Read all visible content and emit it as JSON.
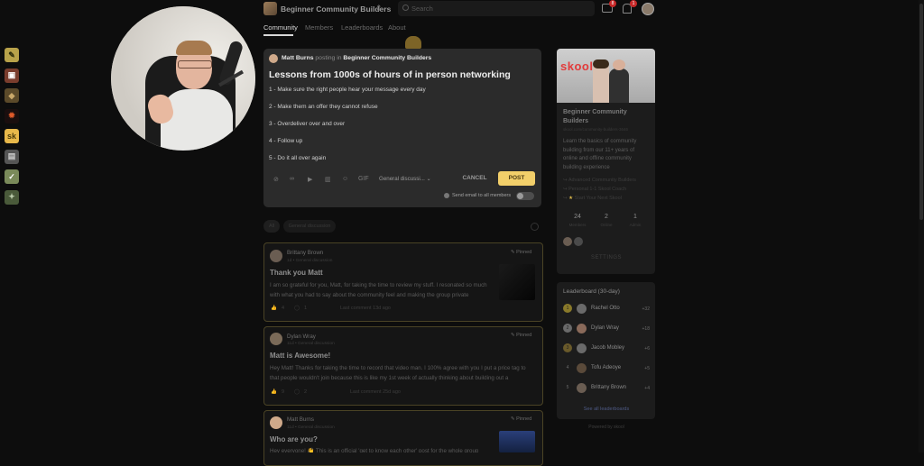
{
  "header": {
    "group_name": "Beginner Community Builders",
    "search_placeholder": "Search",
    "chat_badge": "8",
    "notif_badge": "1"
  },
  "tabs": [
    {
      "label": "Community",
      "active": true
    },
    {
      "label": "Members",
      "active": false
    },
    {
      "label": "Leaderboards",
      "active": false
    },
    {
      "label": "About",
      "active": false
    }
  ],
  "composer": {
    "author": "Matt Burns",
    "posting_in": "posting in",
    "group": "Beginner Community Builders",
    "title": "Lessons from 1000s of hours of in person networking",
    "lines": [
      "1 - Make sure the right people hear your message every day",
      "2 - Make them an offer they cannot refuse",
      "3 - Overdeliver over and over",
      "4 - Follow up",
      "5 - Do it all over again"
    ],
    "gif_label": "GIF",
    "category": "General discussi...",
    "cancel_label": "CANCEL",
    "post_label": "POST",
    "send_email_label": "Send email to all members"
  },
  "filters": {
    "all": "All",
    "general": "General discussion"
  },
  "posts": [
    {
      "author": "Brittany Brown",
      "meta": "1d • General discussion",
      "pinned": "Pinned",
      "title": "Thank you Matt",
      "body": "I am so grateful for you, Matt, for taking the time to review my stuff. I resonated so much with what you had to say about the community feel and making the group private",
      "likes": "4",
      "comments": "1",
      "last_comment": "Last comment 13d ago"
    },
    {
      "author": "Dylan Wray",
      "meta": "11d • General discussion",
      "pinned": "Pinned",
      "title": "Matt is Awesome!",
      "body": "Hey Matt! Thanks for taking the time to record that video man. I 100% agree with you I put a price tag to that people wouldn't join because this is like my 1st week of actually thinking about building out a",
      "likes": "9",
      "comments": "2",
      "last_comment": "Last comment 25d ago"
    },
    {
      "author": "Matt Burns",
      "meta": "11d • General discussion",
      "pinned": "Pinned",
      "title": "Who are you?",
      "body": "Hey everyone! 👋 This is an official 'get to know each other' post for the whole group",
      "likes": "",
      "comments": "",
      "last_comment": ""
    }
  ],
  "group_card": {
    "banner_text": "skool",
    "title": "Beginner Community Builders",
    "url": "skool.com/community-builders-3646",
    "description": "Learn the basics of community building from our 11+ years of online and offline community building experience",
    "links": [
      "Advanced Community Builders",
      "Personal 1-1 Skool Coach",
      "Start Your Next Skool"
    ],
    "stats": [
      {
        "num": "24",
        "label": "Members"
      },
      {
        "num": "2",
        "label": "Online"
      },
      {
        "num": "1",
        "label": "Admin"
      }
    ],
    "settings_label": "SETTINGS"
  },
  "leaderboard": {
    "title": "Leaderboard (30-day)",
    "rows": [
      {
        "rank": "1",
        "name": "Rachel Otto",
        "pts": "+32"
      },
      {
        "rank": "2",
        "name": "Dylan Wray",
        "pts": "+18"
      },
      {
        "rank": "3",
        "name": "Jacob Mobley",
        "pts": "+6"
      },
      {
        "rank": "4",
        "name": "Tofu Adeoye",
        "pts": "+5"
      },
      {
        "rank": "5",
        "name": "Brittany Brown",
        "pts": "+4"
      }
    ],
    "see_all": "See all leaderboards",
    "powered": "Powered by skool"
  },
  "colors": {
    "accent": "#f2cf6a",
    "background": "#0d0d0d",
    "composer_bg": "#2b2b2b"
  }
}
